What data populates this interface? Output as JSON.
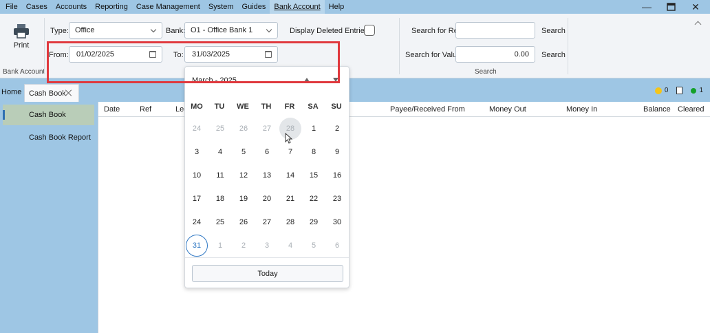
{
  "menu": [
    "File",
    "Cases",
    "Accounts",
    "Reporting",
    "Case Management",
    "System",
    "Guides",
    "Bank Account",
    "Help"
  ],
  "ribbon": {
    "print_label": "Print",
    "group_bank_account": "Bank Account",
    "type_label": "Type:",
    "type_value": "Office",
    "bank_label": "Bank:",
    "bank_value": "O1 - Office Bank 1",
    "display_deleted_label": "Display Deleted Entries :",
    "from_label": "From:",
    "from_value": "01/02/2025",
    "to_label": "To:",
    "to_value": "31/03/2025",
    "search_ref_label": "Search for Ref:",
    "search_ref_value": "",
    "search_value_label": "Search for Value:",
    "search_value_value": "0.00",
    "search_button": "Search",
    "group_search": "Search"
  },
  "tabs": {
    "home": "Home",
    "active": "Cash Book",
    "status_bulb_count": "0",
    "status_green_count": "1"
  },
  "sidebar": {
    "items": [
      "Cash Book",
      "Cash Book Report"
    ]
  },
  "grid": {
    "columns": [
      "Date",
      "Ref",
      "Led",
      "Payee/Received From",
      "Money Out",
      "Money In",
      "Balance",
      "Cleared"
    ]
  },
  "calendar": {
    "header": "March - 2025",
    "weekdays": [
      "MO",
      "TU",
      "WE",
      "TH",
      "FR",
      "SA",
      "SU"
    ],
    "weeks": [
      [
        "24",
        "25",
        "26",
        "27",
        "28",
        "1",
        "2"
      ],
      [
        "3",
        "4",
        "5",
        "6",
        "7",
        "8",
        "9"
      ],
      [
        "10",
        "11",
        "12",
        "13",
        "14",
        "15",
        "16"
      ],
      [
        "17",
        "18",
        "19",
        "20",
        "21",
        "22",
        "23"
      ],
      [
        "24",
        "25",
        "26",
        "27",
        "28",
        "29",
        "30"
      ],
      [
        "31",
        "1",
        "2",
        "3",
        "4",
        "5",
        "6"
      ]
    ],
    "today_button": "Today"
  },
  "colors": {
    "app_bg": "#9ec6e4",
    "highlight": "#e0393e",
    "selected_day": "#2f78c4",
    "active_side": "#b9cdb8"
  }
}
